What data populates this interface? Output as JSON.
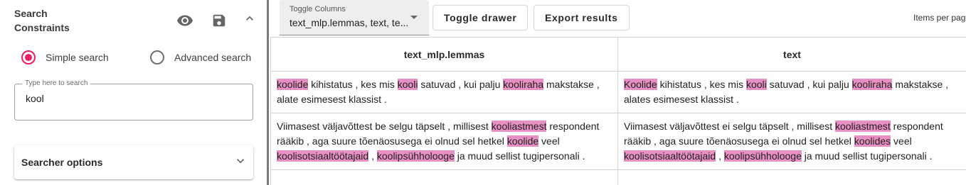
{
  "drawer": {
    "title_line1": "Search",
    "title_line2": "Constraints",
    "icons": {
      "visibility": "eye-icon",
      "save": "floppy-disk-icon",
      "collapse": "chevron-up-icon"
    },
    "search_modes": [
      {
        "label": "Simple search",
        "selected": true
      },
      {
        "label": "Advanced search",
        "selected": false
      }
    ],
    "search": {
      "legend": "Type here to search",
      "value": "kool"
    },
    "searcher_options_label": "Searcher options",
    "accent_color": "#e91e63"
  },
  "toolbar": {
    "toggle_columns_label": "Toggle Columns",
    "toggle_columns_value": "text_mlp.lemmas, text, te...",
    "toggle_drawer_label": "Toggle drawer",
    "export_results_label": "Export results",
    "items_per_page_label": "Items per page"
  },
  "table": {
    "highlight_color": "#e88fc4",
    "columns": [
      "text_mlp.lemmas",
      "text"
    ],
    "rows": [
      {
        "lemmas": [
          {
            "t": "koolide",
            "h": true
          },
          {
            "t": " kihistatus , kes mis "
          },
          {
            "t": "kooli",
            "h": true
          },
          {
            "t": " satuvad , kui palju "
          },
          {
            "t": "kooliraha",
            "h": true
          },
          {
            "t": " makstakse , alate esimesest klassist ."
          }
        ],
        "text": [
          {
            "t": "Koolide",
            "h": true
          },
          {
            "t": " kihistatus , kes mis "
          },
          {
            "t": "kooli",
            "h": true
          },
          {
            "t": " satuvad , kui palju "
          },
          {
            "t": "kooliraha",
            "h": true
          },
          {
            "t": " makstakse , alates esimesest klassist ."
          }
        ]
      },
      {
        "lemmas": [
          {
            "t": "Viimasest väljavõttest be selgu täpselt , millisest "
          },
          {
            "t": "kooliastmest",
            "h": true
          },
          {
            "t": " respondent rääkib , aga suure tõenäosusega ei olnud sel hetkel "
          },
          {
            "t": "koolide",
            "h": true
          },
          {
            "t": " veel "
          },
          {
            "t": "koolisotsiaaltöötajaid",
            "h": true
          },
          {
            "t": " , "
          },
          {
            "t": "koolipsühholooge",
            "h": true
          },
          {
            "t": " ja muud sellist tugipersonali ."
          }
        ],
        "text": [
          {
            "t": "Viimasest väljavõttest ei selgu täpselt , millisest "
          },
          {
            "t": "kooliastmest",
            "h": true
          },
          {
            "t": " respondent rääkib , aga suure tõenäosusega ei olnud sel hetkel "
          },
          {
            "t": "koolides",
            "h": true
          },
          {
            "t": " veel "
          },
          {
            "t": "koolisotsiaaltöötajaid",
            "h": true
          },
          {
            "t": " , "
          },
          {
            "t": "koolipsühholooge",
            "h": true
          },
          {
            "t": " ja muud sellist tugipersonali ."
          }
        ]
      },
      {
        "lemmas": [],
        "text": []
      }
    ]
  }
}
